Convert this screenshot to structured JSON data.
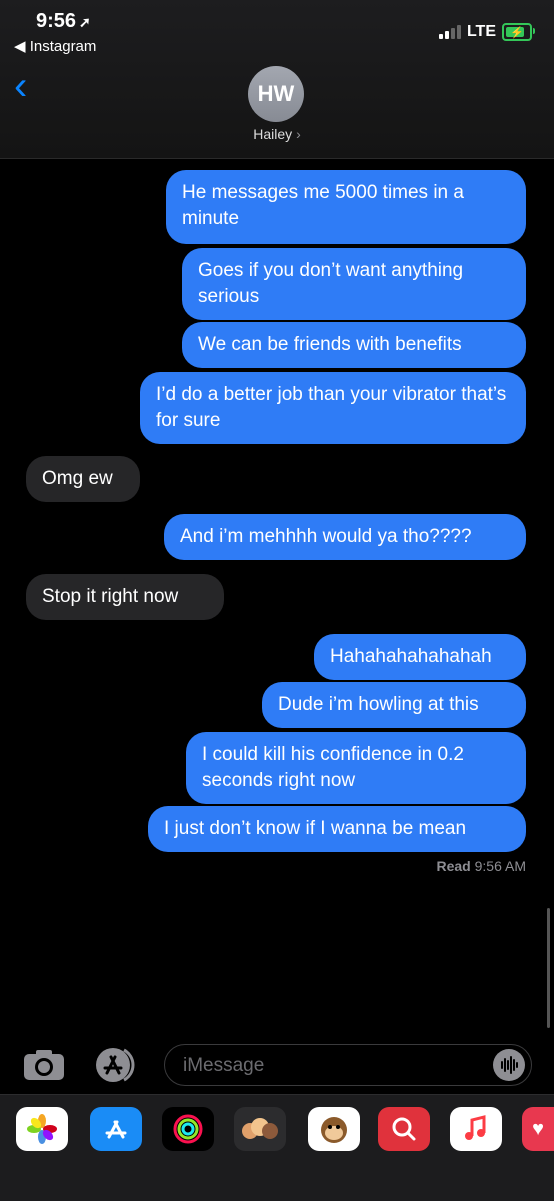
{
  "status": {
    "time": "9:56",
    "back_app": "◀ Instagram",
    "carrier": "LTE"
  },
  "header": {
    "avatar_initials": "HW",
    "contact_name": "Hailey"
  },
  "messages": [
    {
      "from": "me",
      "text": "He messages me 5000 times in a minute"
    },
    {
      "from": "me",
      "text": "Goes if you don’t want anything serious"
    },
    {
      "from": "me",
      "text": "We can be friends with benefits"
    },
    {
      "from": "me",
      "text": "I’d do a better job than your vibrator that’s for sure"
    },
    {
      "from": "them",
      "text": "Omg ew"
    },
    {
      "from": "me",
      "text": "And i’m mehhhh would ya tho????"
    },
    {
      "from": "them",
      "text": "Stop it right now"
    },
    {
      "from": "me",
      "text": "Hahahahahahahah"
    },
    {
      "from": "me",
      "text": "Dude i’m howling at this"
    },
    {
      "from": "me",
      "text": "I could kill his confidence in 0.2 seconds right now"
    },
    {
      "from": "me",
      "text": "I just don’t know if I wanna be mean"
    }
  ],
  "read_receipt": {
    "label": "Read",
    "time": "9:56 AM"
  },
  "input": {
    "placeholder": "iMessage"
  },
  "drawer_apps": [
    "photos-icon",
    "app-store-icon",
    "activity-icon",
    "memoji-icon",
    "animoji-icon",
    "web-search-icon",
    "music-icon",
    "heart-icon"
  ],
  "colors": {
    "sent": "#2f7cf6",
    "received": "#262628",
    "accent": "#0a84ff"
  }
}
